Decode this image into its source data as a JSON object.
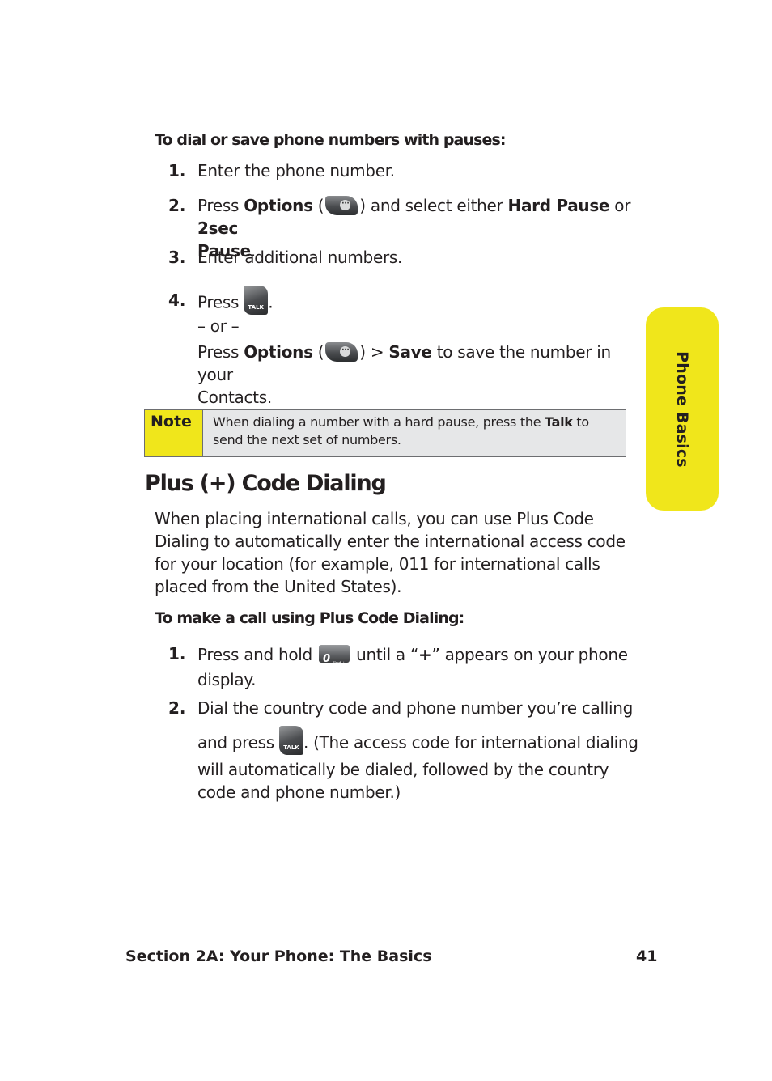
{
  "section1": {
    "subhead": "To dial or save phone numbers with pauses:",
    "steps": [
      {
        "num": "1.",
        "text": "Enter the phone number."
      },
      {
        "num": "2.",
        "pre": "Press ",
        "bold1": "Options",
        "mid1": " (",
        "mid2": ") and select either ",
        "bold2": "Hard Pause",
        "mid3": " or ",
        "bold3": "2sec",
        "bold4": "Pause",
        "end": "."
      },
      {
        "num": "3.",
        "text": "Enter additional numbers."
      },
      {
        "num": "4.",
        "pre": "Press ",
        "end": ".",
        "or": "– or –",
        "alt_pre": "Press ",
        "alt_bold1": "Options",
        "alt_mid1": " (",
        "alt_mid2": ") > ",
        "alt_bold2": "Save",
        "alt_end1": " to save the number in your",
        "alt_end2": "Contacts."
      }
    ]
  },
  "note": {
    "label": "Note",
    "text_pre": "When dialing a number with a hard pause, press the ",
    "text_bold": "Talk",
    "text_post": " to",
    "text_line2": "send the next set of numbers."
  },
  "section2": {
    "heading": "Plus (+) Code Dialing",
    "paragraph": [
      "When placing international calls, you can use Plus Code",
      "Dialing to automatically enter the international access code",
      "for your location (for example, 011 for international calls",
      "placed from the United States)."
    ],
    "subhead": "To make a call using Plus Code Dialing:",
    "steps": [
      {
        "num": "1.",
        "pre": "Press and hold ",
        "mid": " until a “",
        "bold": "+",
        "post": "” appears on your phone",
        "line2": "display."
      },
      {
        "num": "2.",
        "line1": "Dial the country code and phone number you’re calling",
        "pre2": "and press ",
        "post2": ". (The access code for international dialing",
        "line3": "will automatically be dialed, followed by the country",
        "line4": "code and phone number.)"
      }
    ]
  },
  "keys": {
    "options_glyph": "···",
    "talk_label": "TALK",
    "zero_label": "0",
    "zero_sub": "Next +"
  },
  "side_tab": {
    "label": "Phone Basics",
    "color": "#f0e61b"
  },
  "footer": {
    "section": "Section 2A: Your Phone: The Basics",
    "page": "41"
  }
}
